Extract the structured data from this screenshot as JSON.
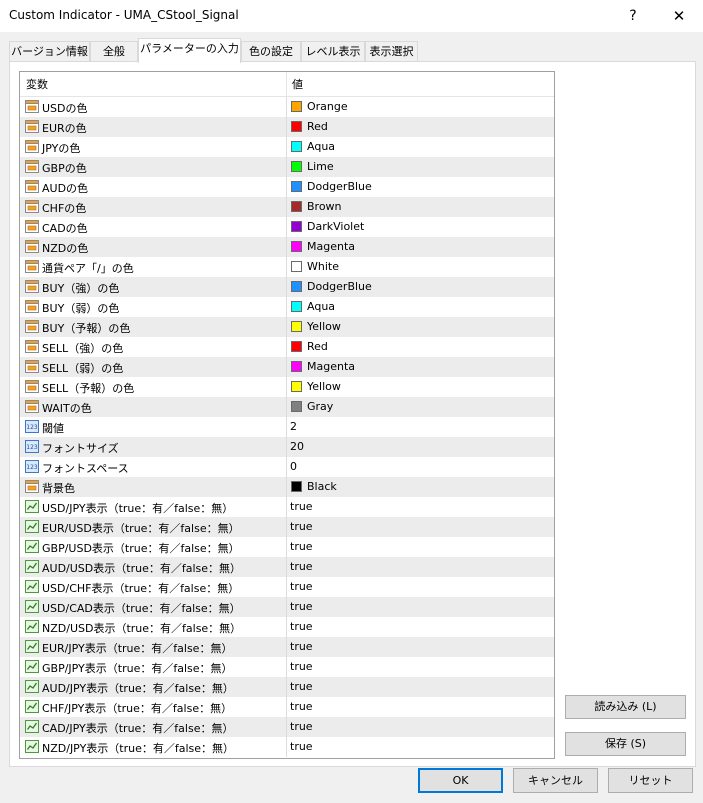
{
  "window": {
    "title": "Custom Indicator - UMA_CStool_Signal",
    "help": "?",
    "close": "✕"
  },
  "tabs": [
    "バージョン情報",
    "全般",
    "パラメーターの入力",
    "色の設定",
    "レベル表示",
    "表示選択"
  ],
  "grid": {
    "col_variable": "変数",
    "col_value": "値",
    "rows": [
      {
        "name": "USDの色",
        "type": "color",
        "value": "Orange",
        "color": "#FFA500"
      },
      {
        "name": "EURの色",
        "type": "color",
        "value": "Red",
        "color": "#FF0000"
      },
      {
        "name": "JPYの色",
        "type": "color",
        "value": "Aqua",
        "color": "#00FFFF"
      },
      {
        "name": "GBPの色",
        "type": "color",
        "value": "Lime",
        "color": "#00FF00"
      },
      {
        "name": "AUDの色",
        "type": "color",
        "value": "DodgerBlue",
        "color": "#1E90FF"
      },
      {
        "name": "CHFの色",
        "type": "color",
        "value": "Brown",
        "color": "#A52A2A"
      },
      {
        "name": "CADの色",
        "type": "color",
        "value": "DarkViolet",
        "color": "#9400D3"
      },
      {
        "name": "NZDの色",
        "type": "color",
        "value": "Magenta",
        "color": "#FF00FF"
      },
      {
        "name": "通貨ペア「/」の色",
        "type": "color",
        "value": "White",
        "color": "#FFFFFF"
      },
      {
        "name": "BUY（強）の色",
        "type": "color",
        "value": "DodgerBlue",
        "color": "#1E90FF"
      },
      {
        "name": "BUY（弱）の色",
        "type": "color",
        "value": "Aqua",
        "color": "#00FFFF"
      },
      {
        "name": "BUY（予報）の色",
        "type": "color",
        "value": "Yellow",
        "color": "#FFFF00"
      },
      {
        "name": "SELL（強）の色",
        "type": "color",
        "value": "Red",
        "color": "#FF0000"
      },
      {
        "name": "SELL（弱）の色",
        "type": "color",
        "value": "Magenta",
        "color": "#FF00FF"
      },
      {
        "name": "SELL（予報）の色",
        "type": "color",
        "value": "Yellow",
        "color": "#FFFF00"
      },
      {
        "name": "WAITの色",
        "type": "color",
        "value": "Gray",
        "color": "#808080"
      },
      {
        "name": "閾値",
        "type": "int",
        "value": "2"
      },
      {
        "name": "フォントサイズ",
        "type": "int",
        "value": "20"
      },
      {
        "name": "フォントスペース",
        "type": "int",
        "value": "0"
      },
      {
        "name": "背景色",
        "type": "color",
        "value": "Black",
        "color": "#000000"
      },
      {
        "name": "USD/JPY表示（true：有／false：無）",
        "type": "bool",
        "value": "true"
      },
      {
        "name": "EUR/USD表示（true：有／false：無）",
        "type": "bool",
        "value": "true"
      },
      {
        "name": "GBP/USD表示（true：有／false：無）",
        "type": "bool",
        "value": "true"
      },
      {
        "name": "AUD/USD表示（true：有／false：無）",
        "type": "bool",
        "value": "true"
      },
      {
        "name": "USD/CHF表示（true：有／false：無）",
        "type": "bool",
        "value": "true"
      },
      {
        "name": "USD/CAD表示（true：有／false：無）",
        "type": "bool",
        "value": "true"
      },
      {
        "name": "NZD/USD表示（true：有／false：無）",
        "type": "bool",
        "value": "true"
      },
      {
        "name": "EUR/JPY表示（true：有／false：無）",
        "type": "bool",
        "value": "true"
      },
      {
        "name": "GBP/JPY表示（true：有／false：無）",
        "type": "bool",
        "value": "true"
      },
      {
        "name": "AUD/JPY表示（true：有／false：無）",
        "type": "bool",
        "value": "true"
      },
      {
        "name": "CHF/JPY表示（true：有／false：無）",
        "type": "bool",
        "value": "true"
      },
      {
        "name": "CAD/JPY表示（true：有／false：無）",
        "type": "bool",
        "value": "true"
      },
      {
        "name": "NZD/JPY表示（true：有／false：無）",
        "type": "bool",
        "value": "true"
      }
    ]
  },
  "icons": {
    "color": "color-param-icon",
    "int": "int-param-icon",
    "bool": "bool-param-icon"
  },
  "int_icon_text": "123",
  "buttons": {
    "load": "読み込み (L)",
    "save": "保存 (S)",
    "ok": "OK",
    "cancel": "キャンセル",
    "reset": "リセット"
  }
}
